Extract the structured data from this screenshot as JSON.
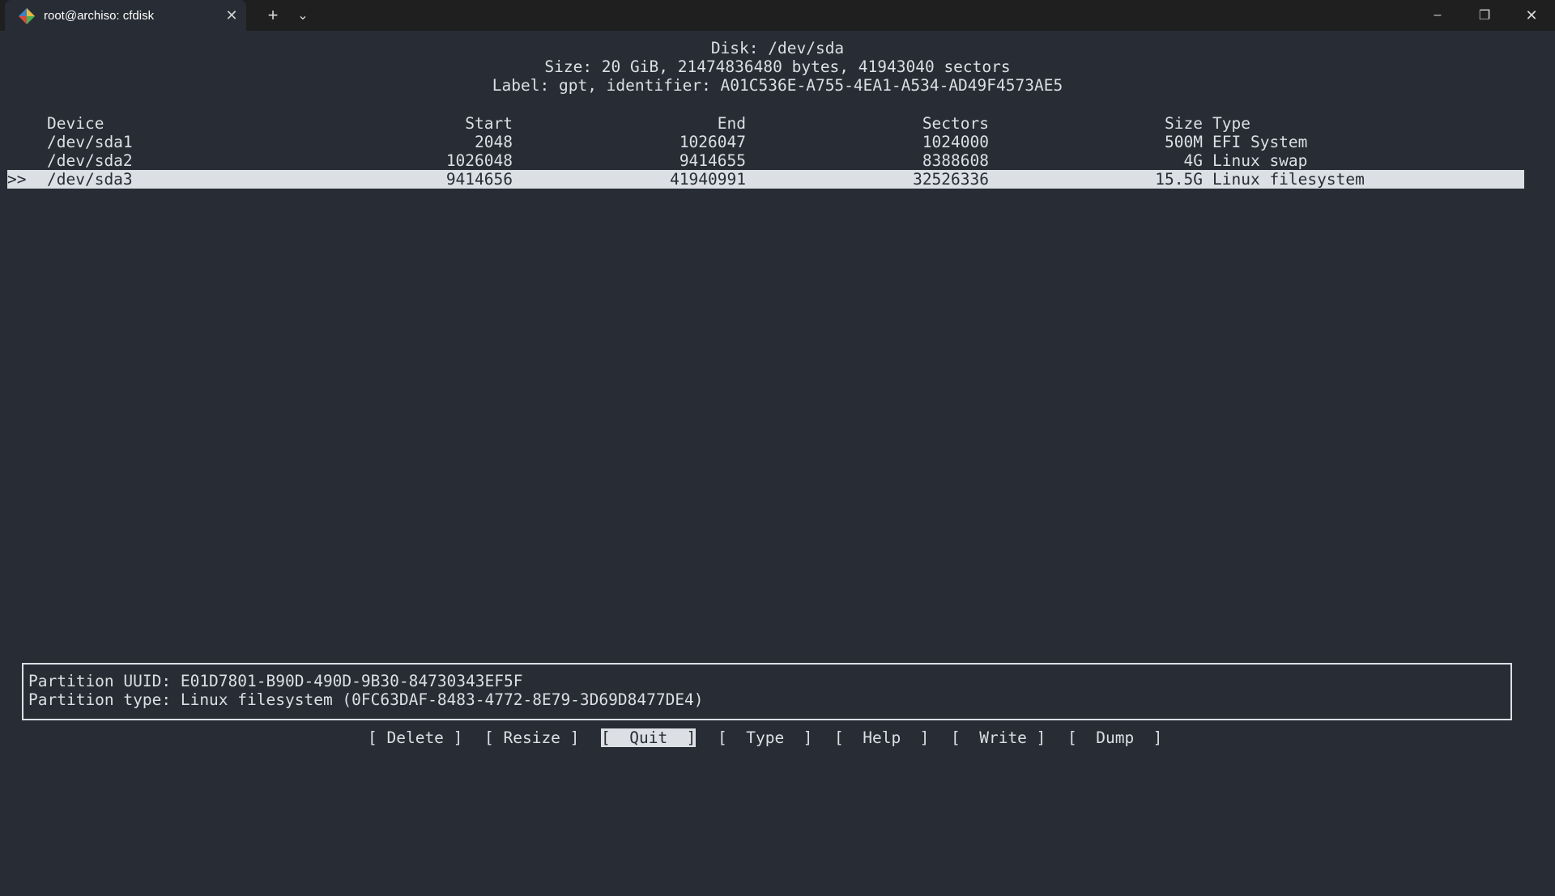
{
  "window": {
    "tab_title": "root@archiso: cfdisk",
    "tab_icon": "terminal-app-icon",
    "new_tab_symbol": "+",
    "dropdown_symbol": "⌄",
    "minimize_symbol": "–",
    "restore_symbol": "❐",
    "close_symbol": "✕",
    "tab_close_symbol": "✕"
  },
  "disk": {
    "line1": "Disk: /dev/sda",
    "line2": "Size: 20 GiB, 21474836480 bytes, 41943040 sectors",
    "line3": "Label: gpt, identifier: A01C536E-A755-4EA1-A534-AD49F4573AE5"
  },
  "table": {
    "headers": {
      "device": "Device",
      "start": "Start",
      "end": "End",
      "sectors": "Sectors",
      "size": "Size",
      "type": "Type"
    },
    "rows": [
      {
        "marker": "",
        "device": "/dev/sda1",
        "start": "2048",
        "end": "1026047",
        "sectors": "1024000",
        "size": "500M",
        "type": "EFI System"
      },
      {
        "marker": "",
        "device": "/dev/sda2",
        "start": "1026048",
        "end": "9414655",
        "sectors": "8388608",
        "size": "4G",
        "type": "Linux swap"
      },
      {
        "marker": ">>",
        "device": "/dev/sda3",
        "start": "9414656",
        "end": "41940991",
        "sectors": "32526336",
        "size": "15.5G",
        "type": "Linux filesystem"
      }
    ]
  },
  "info": {
    "uuid_line": "Partition UUID: E01D7801-B90D-490D-9B30-84730343EF5F",
    "type_line": "Partition type: Linux filesystem (0FC63DAF-8483-4772-8E79-3D69D8477DE4)"
  },
  "menu": {
    "delete": "[ Delete ]",
    "resize": "[ Resize ]",
    "quit": "[  Quit  ]",
    "type": "[  Type  ]",
    "help": "[  Help  ]",
    "write": "[  Write ]",
    "dump": "[  Dump  ]"
  },
  "colors": {
    "background": "#282c34",
    "foreground": "#dcdfe4",
    "titlebar": "#1f1f1f"
  }
}
